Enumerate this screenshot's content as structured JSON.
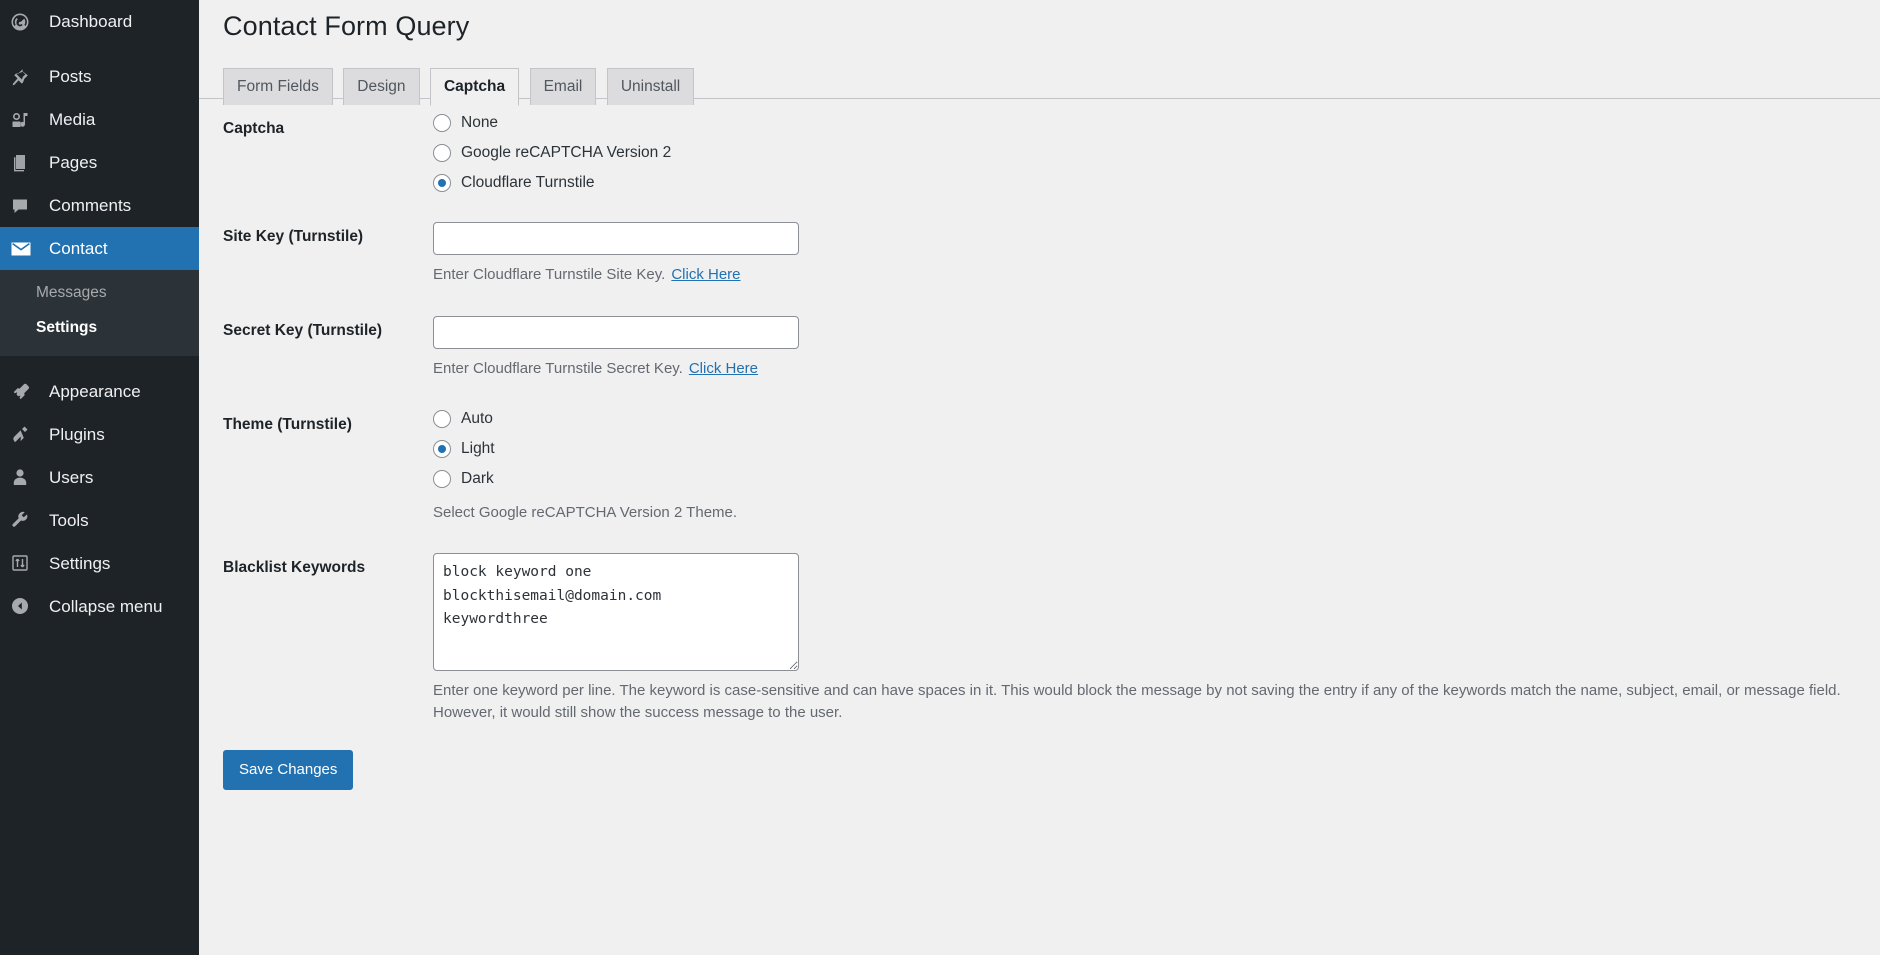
{
  "sidebar": {
    "items": [
      {
        "label": "Dashboard",
        "icon": "dashboard-icon",
        "current": false
      },
      {
        "label": "Posts",
        "icon": "pin-icon",
        "current": false
      },
      {
        "label": "Media",
        "icon": "media-icon",
        "current": false
      },
      {
        "label": "Pages",
        "icon": "pages-icon",
        "current": false
      },
      {
        "label": "Comments",
        "icon": "comments-icon",
        "current": false
      },
      {
        "label": "Contact",
        "icon": "email-icon",
        "current": true
      },
      {
        "label": "Appearance",
        "icon": "appearance-brush-icon",
        "current": false
      },
      {
        "label": "Plugins",
        "icon": "plugin-icon",
        "current": false
      },
      {
        "label": "Users",
        "icon": "users-icon",
        "current": false
      },
      {
        "label": "Tools",
        "icon": "tools-wrench-icon",
        "current": false
      },
      {
        "label": "Settings",
        "icon": "settings-sliders-icon",
        "current": false
      },
      {
        "label": "Collapse menu",
        "icon": "collapse-arrow-icon",
        "current": false
      }
    ],
    "submenu": [
      {
        "label": "Messages",
        "current": false
      },
      {
        "label": "Settings",
        "current": true
      }
    ]
  },
  "header": {
    "title": "Contact Form Query"
  },
  "tabs": [
    {
      "label": "Form Fields",
      "active": false
    },
    {
      "label": "Design",
      "active": false
    },
    {
      "label": "Captcha",
      "active": true
    },
    {
      "label": "Email",
      "active": false
    },
    {
      "label": "Uninstall",
      "active": false
    }
  ],
  "form": {
    "captcha": {
      "label": "Captcha",
      "options": [
        {
          "label": "None",
          "selected": false
        },
        {
          "label": "Google reCAPTCHA Version 2",
          "selected": false
        },
        {
          "label": "Cloudflare Turnstile",
          "selected": true
        }
      ]
    },
    "site_key": {
      "label": "Site Key (Turnstile)",
      "value": "",
      "placeholder": "",
      "description": "Enter Cloudflare Turnstile Site Key.",
      "link_text": "Click Here"
    },
    "secret_key": {
      "label": "Secret Key (Turnstile)",
      "value": "",
      "placeholder": "",
      "description": "Enter Cloudflare Turnstile Secret Key.",
      "link_text": "Click Here"
    },
    "theme": {
      "label": "Theme (Turnstile)",
      "options": [
        {
          "label": "Auto",
          "selected": false
        },
        {
          "label": "Light",
          "selected": true
        },
        {
          "label": "Dark",
          "selected": false
        }
      ],
      "description": "Select Google reCAPTCHA Version 2 Theme."
    },
    "blacklist": {
      "label": "Blacklist Keywords",
      "value": "block keyword one\nblockthisemail@domain.com\nkeywordthree",
      "description": "Enter one keyword per line. The keyword is case-sensitive and can have spaces in it. This would block the message by not saving the entry if any of the keywords match the name, subject, email, or message field. However, it would still show the success message to the user."
    },
    "submit_label": "Save Changes"
  },
  "colors": {
    "accent": "#2271b1",
    "sidebar_bg": "#1d2327",
    "submenu_bg": "#2c3338",
    "page_bg": "#f0f0f1",
    "tab_inactive_bg": "#dcdcde"
  }
}
